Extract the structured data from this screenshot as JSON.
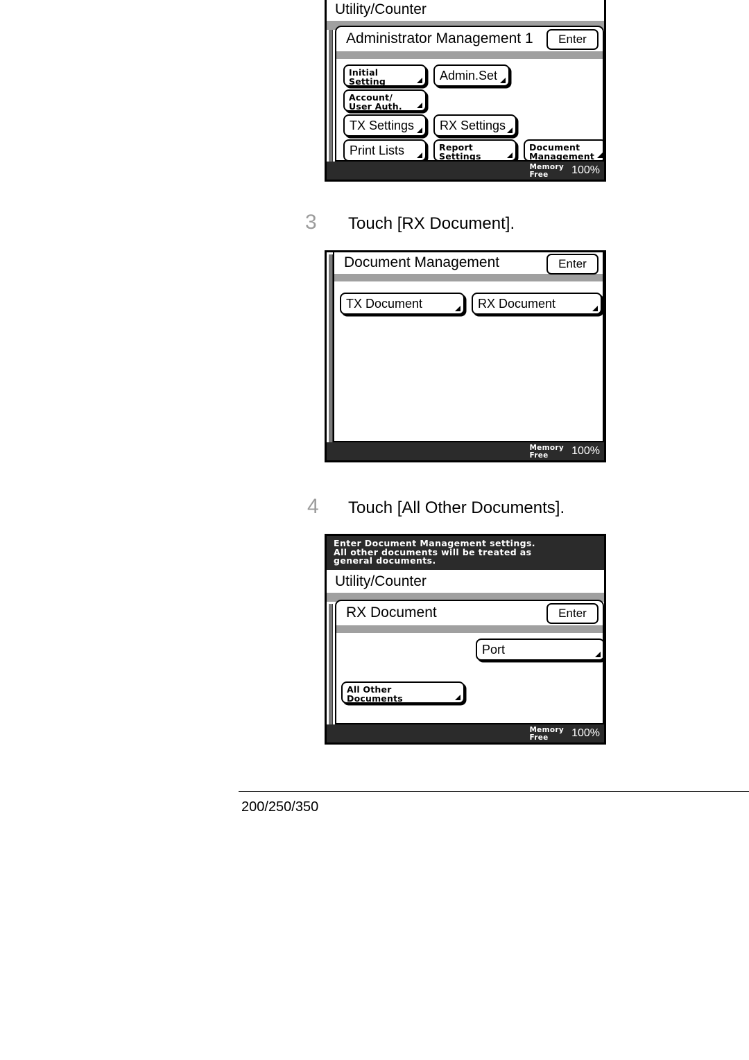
{
  "document": {
    "footer_model": "200/250/350"
  },
  "steps": [
    {
      "number": "3",
      "text": "Touch [RX Document]."
    },
    {
      "number": "4",
      "text": "Touch [All Other Documents]."
    }
  ],
  "panels": {
    "admin_management": {
      "screen_title": "Utility/Counter",
      "card_title": "Administrator Management 1",
      "enter_label": "Enter",
      "buttons": [
        {
          "line1": "Initial",
          "line2": "Setting"
        },
        {
          "line1": "Admin.Set",
          "line2": ""
        },
        {
          "line1": "Account/",
          "line2": "User Auth."
        },
        {
          "line1": "TX Settings",
          "line2": ""
        },
        {
          "line1": "RX Settings",
          "line2": ""
        },
        {
          "line1": "Print Lists",
          "line2": ""
        },
        {
          "line1": "Report",
          "line2": "Settings"
        },
        {
          "line1": "Document",
          "line2": "Management"
        }
      ],
      "status": {
        "memory_label_1": "Memory",
        "memory_label_2": "Free",
        "value": "100%"
      }
    },
    "document_management": {
      "card_title": "Document Management",
      "enter_label": "Enter",
      "buttons": [
        {
          "label": "TX Document"
        },
        {
          "label": "RX Document"
        }
      ],
      "status": {
        "memory_label_1": "Memory",
        "memory_label_2": "Free",
        "value": "100%"
      }
    },
    "rx_document": {
      "message_lines": [
        "Enter Document Management settings.",
        "All other documents will be treated as",
        "general documents."
      ],
      "screen_title": "Utility/Counter",
      "card_title": "RX Document",
      "enter_label": "Enter",
      "port_button": {
        "label": "Port"
      },
      "all_other_button": {
        "line1": "All Other",
        "line2": "Documents"
      },
      "status": {
        "memory_label_1": "Memory",
        "memory_label_2": "Free",
        "value": "100%"
      }
    }
  }
}
